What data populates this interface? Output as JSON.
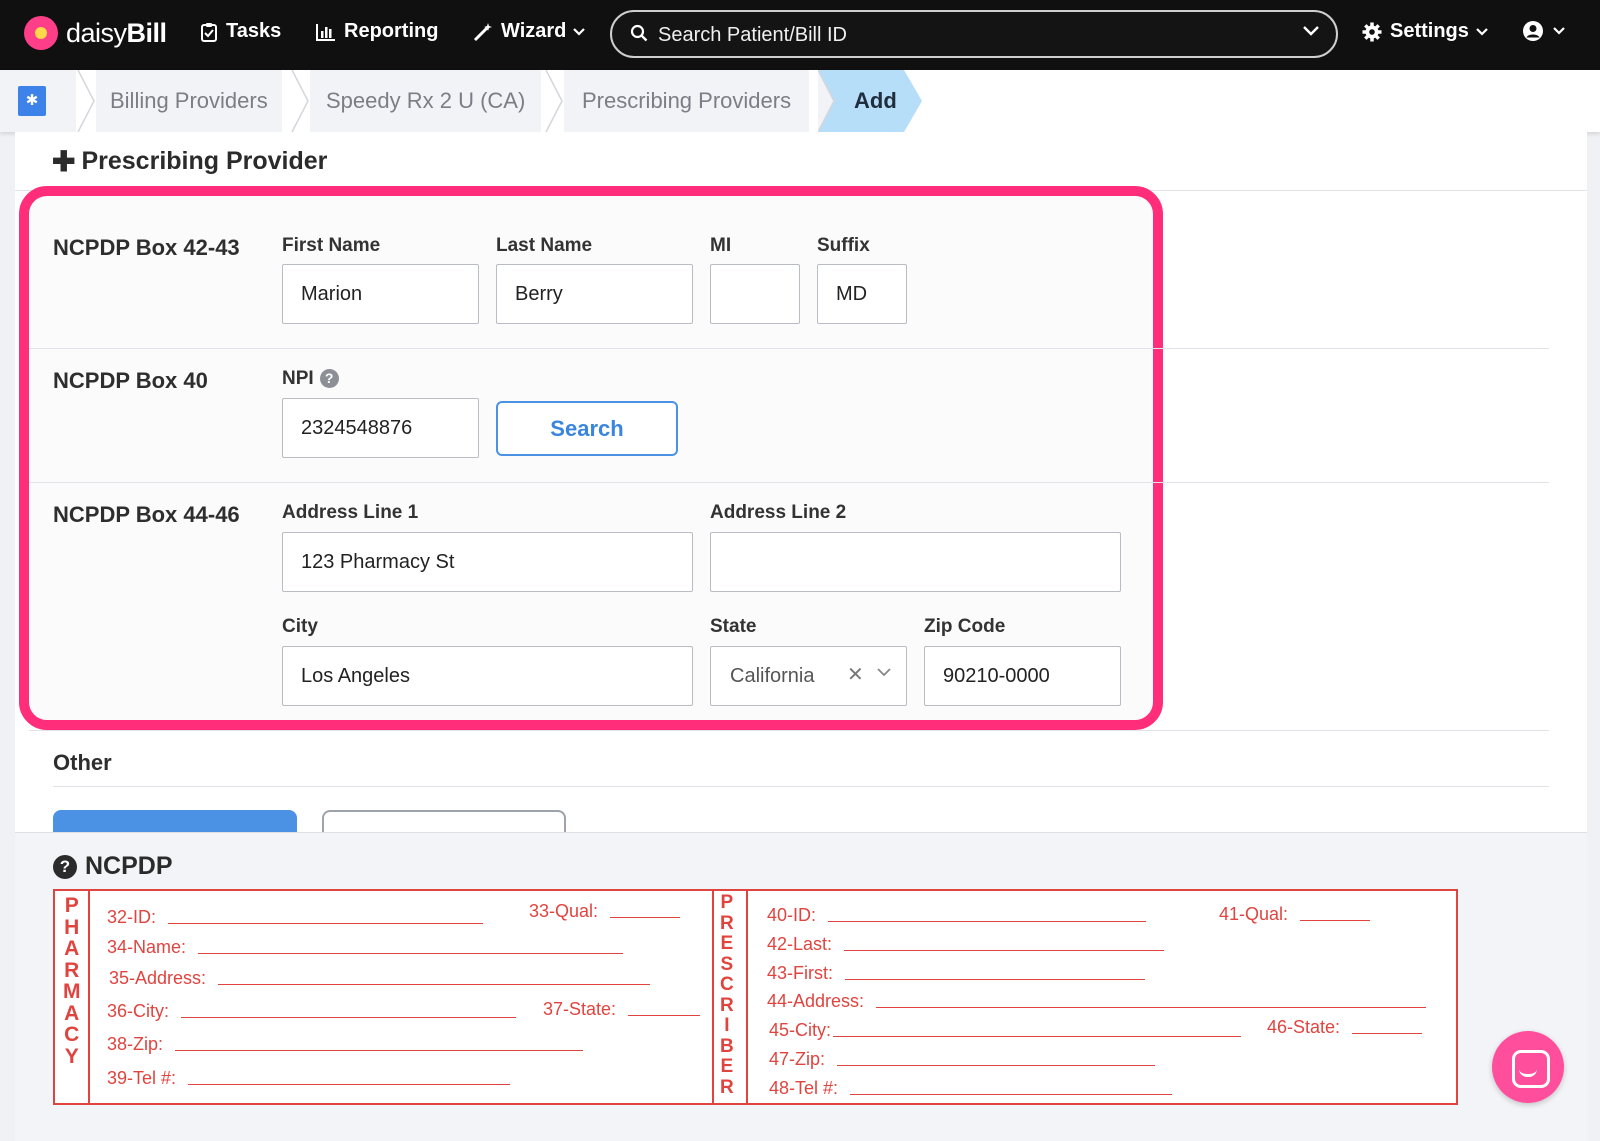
{
  "app": {
    "brand_light": "daisy",
    "brand_bold": "Bill"
  },
  "nav": {
    "tasks": "Tasks",
    "reporting": "Reporting",
    "wizard": "Wizard",
    "search_placeholder": "Search Patient/Bill ID",
    "settings": "Settings"
  },
  "breadcrumb": {
    "items": [
      "Billing Providers",
      "Speedy Rx 2 U (CA)",
      "Prescribing Providers",
      "Add"
    ]
  },
  "page": {
    "title": "Prescribing Provider"
  },
  "form": {
    "box_name": {
      "section": "NCPDP Box 42-43",
      "first_name_label": "First Name",
      "first_name": "Marion",
      "last_name_label": "Last Name",
      "last_name": "Berry",
      "mi_label": "MI",
      "mi": "",
      "suffix_label": "Suffix",
      "suffix": "MD"
    },
    "box_npi": {
      "section": "NCPDP Box 40",
      "npi_label": "NPI",
      "npi": "2324548876",
      "search_button": "Search"
    },
    "box_address": {
      "section": "NCPDP Box 44-46",
      "address1_label": "Address Line 1",
      "address1": "123 Pharmacy St",
      "address2_label": "Address Line 2",
      "address2": "",
      "city_label": "City",
      "city": "Los Angeles",
      "state_label": "State",
      "state": "California",
      "zip_label": "Zip Code",
      "zip": "90210-0000"
    },
    "other_label": "Other"
  },
  "ncpdp": {
    "title": "NCPDP",
    "pharmacy_letters": [
      "P",
      "H",
      "A",
      "R",
      "M",
      "A",
      "C",
      "Y"
    ],
    "prescriber_letters": [
      "P",
      "R",
      "E",
      "S",
      "C",
      "R",
      "I",
      "B",
      "E",
      "R"
    ],
    "pharmacy_fields": {
      "id": "32-ID:",
      "qual": "33-Qual:",
      "name": "34-Name:",
      "address": "35-Address:",
      "city": "36-City:",
      "state": "37-State:",
      "zip": "38-Zip:",
      "tel": "39-Tel #:"
    },
    "prescriber_fields": {
      "id": "40-ID:",
      "qual": "41-Qual:",
      "last": "42-Last:",
      "first": "43-First:",
      "address": "44-Address:",
      "city": "45-City:",
      "state": "46-State:",
      "zip": "47-Zip:",
      "tel": "48-Tel #:"
    }
  },
  "colors": {
    "highlight": "#ff2d7a",
    "primary": "#4b92e4",
    "form_red": "#e0443f",
    "active_crumb": "#b6def9"
  }
}
